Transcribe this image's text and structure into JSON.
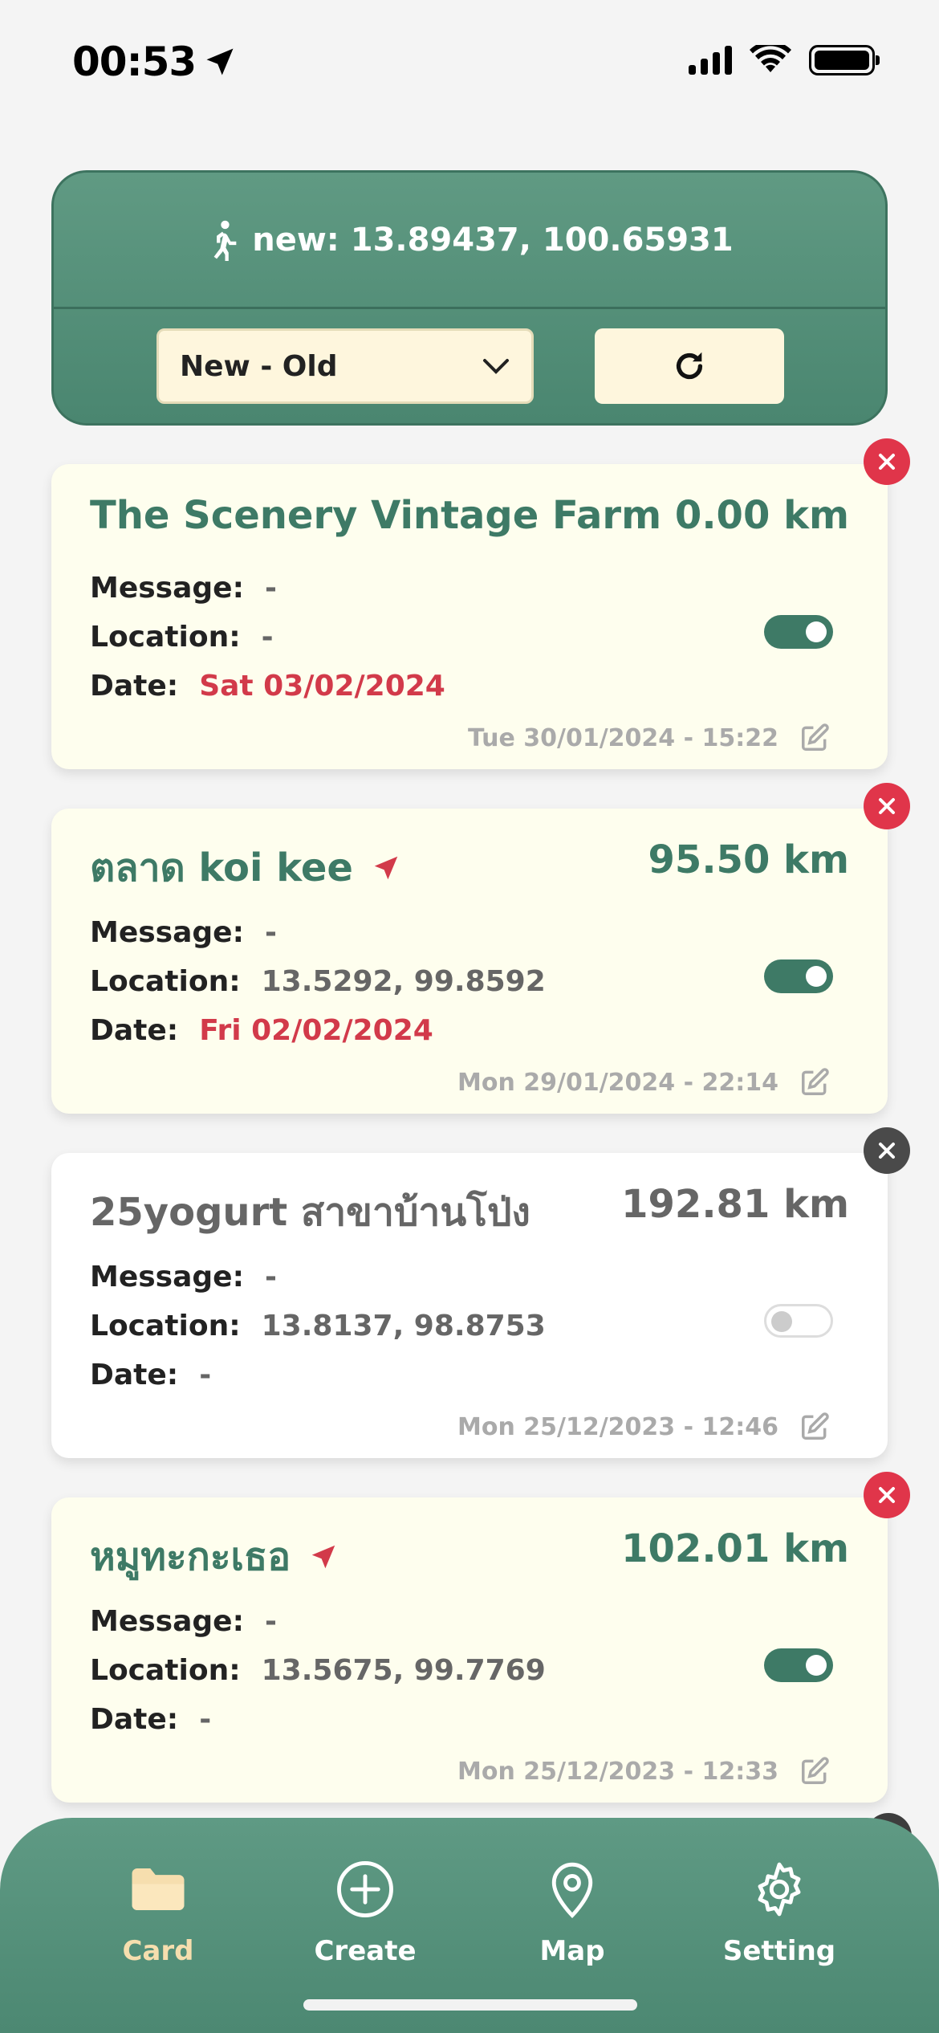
{
  "status_bar": {
    "time": "00:53"
  },
  "header": {
    "location_label": "new: 13.89437, 100.65931",
    "sort_value": "New - Old"
  },
  "labels": {
    "message": "Message:",
    "location": "Location:",
    "date": "Date:"
  },
  "cards": [
    {
      "title": "The Scenery Vintage Farm",
      "distance": "0.00 km",
      "message": "-",
      "location": "-",
      "date": "Sat 03/02/2024",
      "timestamp": "Tue 30/01/2024 - 15:22",
      "enabled": true
    },
    {
      "title": "ตลาด koi kee",
      "distance": "95.50 km",
      "message": "-",
      "location": "13.5292, 99.8592",
      "date": "Fri 02/02/2024",
      "timestamp": "Mon 29/01/2024 - 22:14",
      "enabled": true
    },
    {
      "title": "25yogurt สาขาบ้านโป่ง",
      "distance": "192.81 km",
      "message": "-",
      "location": "13.8137, 98.8753",
      "date": "-",
      "timestamp": "Mon 25/12/2023 - 12:46",
      "enabled": false
    },
    {
      "title": "หมูทะกะเธอ",
      "distance": "102.01 km",
      "message": "-",
      "location": "13.5675, 99.7769",
      "date": "-",
      "timestamp": "Mon 25/12/2023 - 12:33",
      "enabled": true
    }
  ],
  "nav": {
    "card": "Card",
    "create": "Create",
    "map": "Map",
    "setting": "Setting"
  },
  "colors": {
    "brand_green": "#4a8670",
    "accent_cream": "#fef6dd",
    "date_red": "#d23a4a",
    "delete_red": "#e0354a",
    "active_nav": "#f6deae"
  }
}
